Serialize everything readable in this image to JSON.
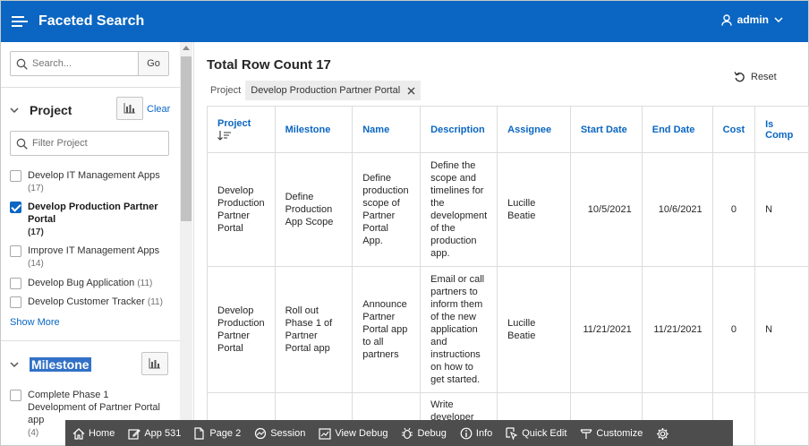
{
  "header": {
    "app_title": "Faceted Search",
    "user_name": "admin",
    "icons": {
      "menu": "hamburger-icon",
      "user": "user-icon",
      "dropdown": "chevron-down-icon"
    }
  },
  "left_pane": {
    "search": {
      "placeholder": "Search...",
      "go_label": "Go"
    },
    "project_facet": {
      "title": "Project",
      "clear_label": "Clear",
      "filter_placeholder": "Filter Project",
      "options": [
        {
          "label": "Develop IT Management Apps",
          "count": "(17)",
          "checked": false
        },
        {
          "label": "Develop Production Partner Portal",
          "count": "(17)",
          "checked": true
        },
        {
          "label": "Improve IT Management Apps",
          "count": "(14)",
          "checked": false
        },
        {
          "label": "Develop Bug Application",
          "count": "(11)",
          "checked": false
        },
        {
          "label": "Develop Customer Tracker",
          "count": "(11)",
          "checked": false
        }
      ],
      "show_more_label": "Show More"
    },
    "milestone_facet": {
      "title": "Milestone",
      "options": [
        {
          "label": "Complete Phase 1 Development of Partner Portal app",
          "count": "(4)",
          "checked": false
        }
      ]
    }
  },
  "main": {
    "total_row_count": "Total Row Count 17",
    "reset_label": "Reset",
    "active_filter": {
      "label": "Project",
      "value": "Develop Production Partner Portal"
    },
    "table": {
      "columns": [
        "Project",
        "Milestone",
        "Name",
        "Description",
        "Assignee",
        "Start Date",
        "End Date",
        "Cost",
        "Is Comp"
      ],
      "rows": [
        {
          "project": "Develop Production Partner Portal",
          "milestone": "Define Production App Scope",
          "name": "Define production scope of Partner Portal App.",
          "description": "Define the scope and timelines for the development of the production app.",
          "assignee": "Lucille Beatie",
          "start_date": "10/5/2021",
          "end_date": "10/6/2021",
          "cost": "0",
          "is_complete": "N"
        },
        {
          "project": "Develop Production Partner Portal",
          "milestone": "Roll out Phase 1 of Partner Portal app",
          "name": "Announce Partner Portal app to all partners",
          "description": "Email or call partners to inform them of the new application and instructions on how to get started.",
          "assignee": "Lucille Beatie",
          "start_date": "11/21/2021",
          "end_date": "11/21/2021",
          "cost": "0",
          "is_complete": "N"
        },
        {
          "project": "",
          "milestone": "",
          "name": "",
          "description": "Write developer",
          "assignee": "",
          "start_date": "",
          "end_date": "",
          "cost": "",
          "is_complete": ""
        }
      ]
    }
  },
  "dev_toolbar": {
    "items": [
      {
        "label": "Home",
        "icon": "home-icon"
      },
      {
        "label": "App 531",
        "icon": "edit-icon"
      },
      {
        "label": "Page 2",
        "icon": "page-edit-icon"
      },
      {
        "label": "Session",
        "icon": "session-icon"
      },
      {
        "label": "View Debug",
        "icon": "view-debug-icon"
      },
      {
        "label": "Debug",
        "icon": "bug-icon"
      },
      {
        "label": "Info",
        "icon": "info-icon"
      },
      {
        "label": "Quick Edit",
        "icon": "quick-edit-icon"
      },
      {
        "label": "Customize",
        "icon": "customize-icon"
      },
      {
        "label": "",
        "icon": "gear-icon"
      }
    ]
  }
}
